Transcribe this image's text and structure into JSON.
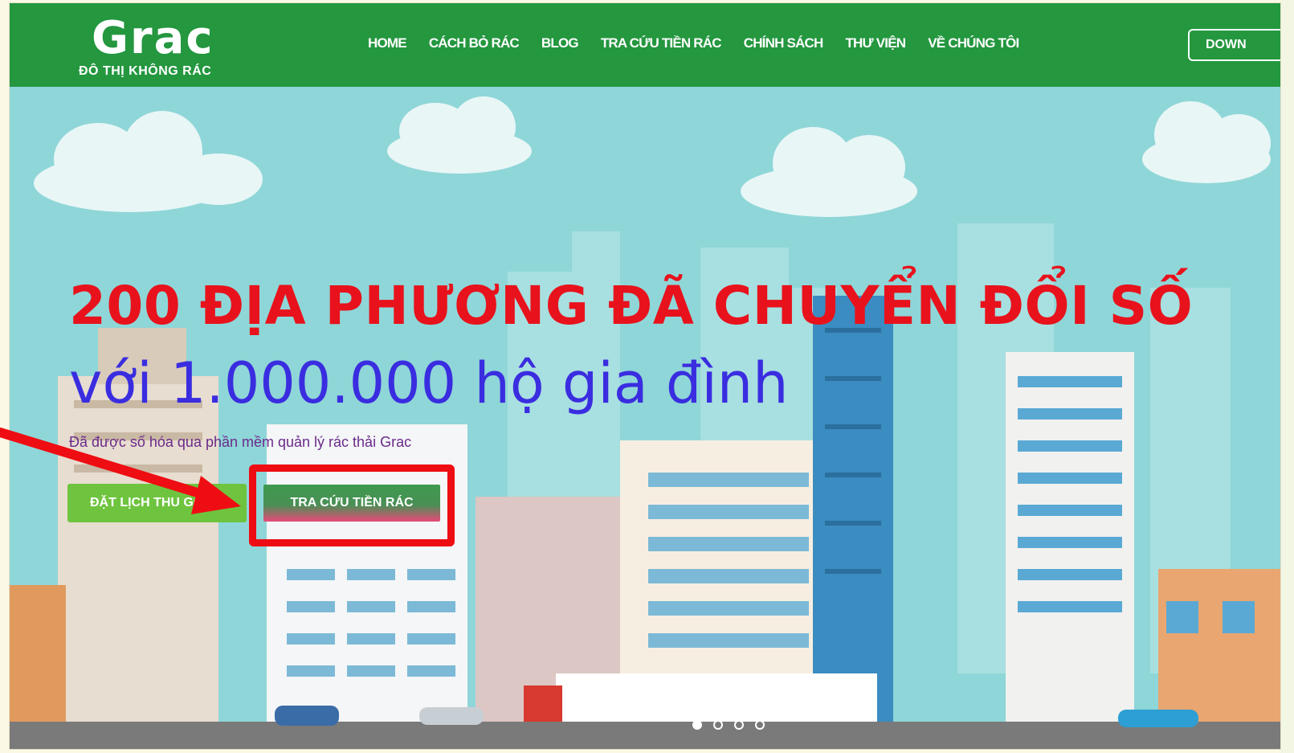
{
  "header": {
    "logo_text": "Grac",
    "logo_tagline": "ĐÔ THỊ KHÔNG RÁC",
    "nav": [
      {
        "label": "HOME"
      },
      {
        "label": "CÁCH BỎ RÁC"
      },
      {
        "label": "BLOG"
      },
      {
        "label": "TRA CỨU TIỀN RÁC"
      },
      {
        "label": "CHÍNH SÁCH"
      },
      {
        "label": "THƯ VIỆN"
      },
      {
        "label": "VỀ CHÚNG TÔI"
      }
    ],
    "download_label": "DOWN"
  },
  "hero": {
    "headline": "200 ĐỊA PHƯƠNG ĐÃ CHUYỂN ĐỔI SỐ",
    "subheadline": "với 1.000.000 hộ gia đình",
    "tagline": "Đã được số hóa qua phần mềm quản lý rác thải Grac",
    "schedule_button": "ĐẶT LỊCH THU GOM",
    "lookup_button": "TRA CỨU TIỀN RÁC"
  },
  "carousel": {
    "slides": 4,
    "active": 1
  },
  "colors": {
    "header_green": "#24973f",
    "headline_red": "#e8121c",
    "subheadline_blue": "#3a2de0",
    "annotation_red": "#ee0d12"
  }
}
